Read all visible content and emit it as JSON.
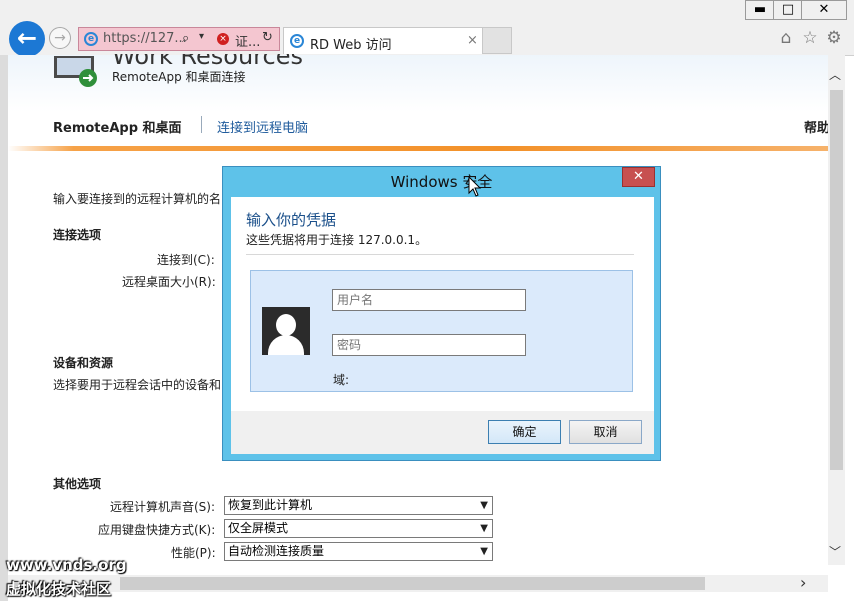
{
  "window": {
    "minimize_label": "▬",
    "maximize_label": "□",
    "close_label": "✕"
  },
  "browser": {
    "back_label": "←",
    "forward_label": "→",
    "address": "https://127...",
    "search_glyph": "⌕",
    "dropdown_glyph": "▾",
    "cert_label": "证...",
    "refresh_glyph": "↻",
    "tab_title": "RD Web 访问",
    "tab_close": "×",
    "home_glyph": "⌂",
    "favorites_glyph": "☆",
    "tools_glyph": "⚙"
  },
  "header": {
    "brand_title": "Work Resources",
    "brand_subtitle": "RemoteApp 和桌面连接",
    "nav_current": "RemoteApp 和桌面",
    "nav_link": "连接到远程电脑",
    "help": "帮助"
  },
  "page": {
    "intro": "输入要连接到的远程计算机的名",
    "connection_heading": "连接选项",
    "connect_to_label": "连接到(C):",
    "remote_size_label": "远程桌面大小(R):",
    "devices_heading": "设备和资源",
    "devices_desc": "选择要用于远程会话中的设备和",
    "other_heading": "其他选项",
    "sound_label": "远程计算机声音(S):",
    "sound_value": "恢复到此计算机",
    "keyboard_label": "应用键盘快捷方式(K):",
    "keyboard_value": "仅全屏模式",
    "performance_label": "性能(P):",
    "performance_value": "自动检测连接质量"
  },
  "dialog": {
    "title": "Windows 安全",
    "close": "✕",
    "heading": "输入你的凭据",
    "subtitle": "这些凭据将用于连接 127.0.0.1。",
    "username_placeholder": "用户名",
    "password_placeholder": "密码",
    "domain_label": "域:",
    "ok": "确定",
    "cancel": "取消"
  },
  "scroll": {
    "up": "︿",
    "down": "﹀",
    "right": "›"
  },
  "watermark": {
    "line1": "www.vnds.org",
    "line2": "虚拟化技术社区"
  }
}
